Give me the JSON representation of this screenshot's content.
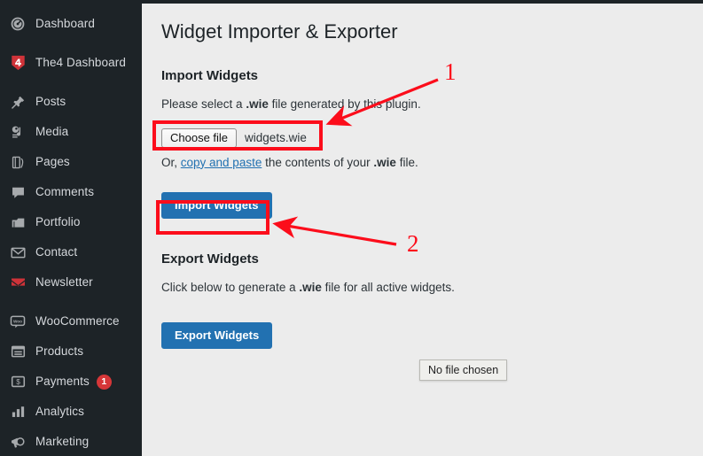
{
  "sidebar": {
    "items": [
      {
        "label": "Dashboard",
        "icon": "dashboard-icon",
        "badge": null,
        "gap_after": true
      },
      {
        "label": "The4 Dashboard",
        "icon": "the4-logo-icon",
        "badge": null,
        "gap_after": true
      },
      {
        "label": "Posts",
        "icon": "pin-icon",
        "badge": null,
        "gap_after": false
      },
      {
        "label": "Media",
        "icon": "media-icon",
        "badge": null,
        "gap_after": false
      },
      {
        "label": "Pages",
        "icon": "pages-icon",
        "badge": null,
        "gap_after": false
      },
      {
        "label": "Comments",
        "icon": "comment-icon",
        "badge": null,
        "gap_after": false
      },
      {
        "label": "Portfolio",
        "icon": "portfolio-icon",
        "badge": null,
        "gap_after": false
      },
      {
        "label": "Contact",
        "icon": "envelope-icon",
        "badge": null,
        "gap_after": false
      },
      {
        "label": "Newsletter",
        "icon": "newsletter-icon",
        "badge": null,
        "gap_after": true
      },
      {
        "label": "WooCommerce",
        "icon": "woocommerce-icon",
        "badge": null,
        "gap_after": false
      },
      {
        "label": "Products",
        "icon": "products-icon",
        "badge": null,
        "gap_after": false
      },
      {
        "label": "Payments",
        "icon": "payments-icon",
        "badge": "1",
        "gap_after": false
      },
      {
        "label": "Analytics",
        "icon": "analytics-icon",
        "badge": null,
        "gap_after": false
      },
      {
        "label": "Marketing",
        "icon": "megaphone-icon",
        "badge": null,
        "gap_after": false
      }
    ]
  },
  "main": {
    "page_title": "Widget Importer & Exporter",
    "import": {
      "heading": "Import Widgets",
      "description_prefix": "Please select a ",
      "description_bold": ".wie",
      "description_suffix": " file generated by this plugin.",
      "choose_file_label": "Choose file",
      "file_name": "widgets.wie",
      "or_prefix": "Or, ",
      "or_link": "copy and paste",
      "or_middle": " the contents of your ",
      "or_bold": ".wie",
      "or_suffix": " file.",
      "import_button_label": "Import Widgets"
    },
    "export": {
      "heading": "Export Widgets",
      "description_prefix": "Click below to generate a ",
      "description_bold": ".wie",
      "description_suffix": " file for all active widgets.",
      "export_button_label": "Export Widgets"
    }
  },
  "tooltip": {
    "no_file_chosen": "No file chosen"
  },
  "annotations": {
    "number_1": "1",
    "number_2": "2",
    "color": "#fc0d1b"
  },
  "colors": {
    "sidebar_bg": "#1d2327",
    "content_bg": "#ececec",
    "primary_button": "#2271b1",
    "link": "#2271b1",
    "badge": "#d63638",
    "annotation_red": "#fc0d1b"
  }
}
